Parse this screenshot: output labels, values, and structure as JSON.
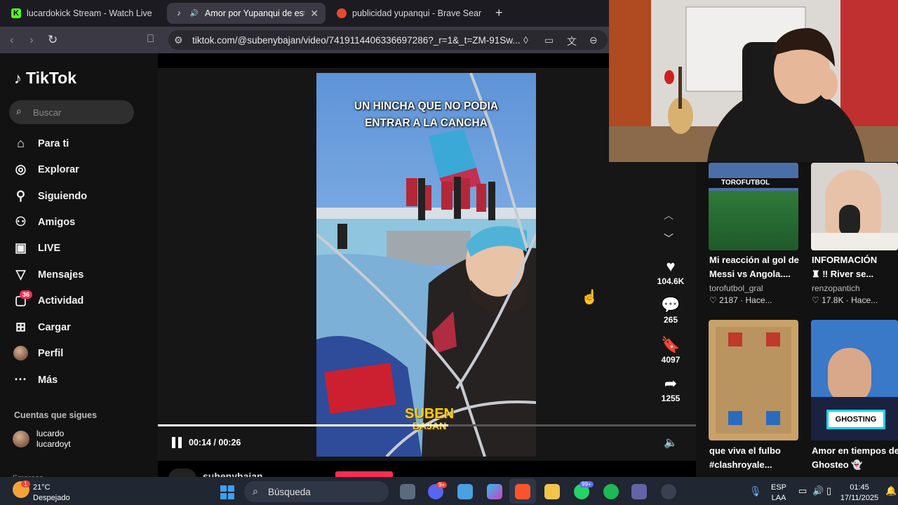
{
  "browser": {
    "tabs": [
      {
        "title": "lucardokick Stream - Watch Live on Kick",
        "icon": "kick-icon",
        "active": false
      },
      {
        "title": "Amor por Yupanqui de este hincha",
        "icon": "tiktok-icon",
        "active": true
      },
      {
        "title": "publicidad yupanqui - Brave Search",
        "icon": "brave-icon",
        "active": false
      }
    ],
    "url": "tiktok.com/@subenybajan/video/7419114406336697286?_r=1&_t=ZM-91Sw..."
  },
  "tiktok": {
    "logo": "TikTok",
    "search_placeholder": "Buscar",
    "nav": [
      {
        "label": "Para ti",
        "icon": "home-icon"
      },
      {
        "label": "Explorar",
        "icon": "compass-icon"
      },
      {
        "label": "Siguiendo",
        "icon": "following-icon"
      },
      {
        "label": "Amigos",
        "icon": "friends-icon"
      },
      {
        "label": "LIVE",
        "icon": "live-icon"
      },
      {
        "label": "Mensajes",
        "icon": "messages-icon"
      },
      {
        "label": "Actividad",
        "icon": "activity-icon"
      },
      {
        "label": "Cargar",
        "icon": "upload-icon"
      },
      {
        "label": "Perfil",
        "icon": "profile-avatar"
      },
      {
        "label": "Más",
        "icon": "more-icon"
      }
    ],
    "activity_badge": "36",
    "following_title": "Cuentas que sigues",
    "followed_account": {
      "name": "lucardo",
      "handle": "lucardoyt"
    },
    "footer_label": "Empresa"
  },
  "video": {
    "caption_line1": "UN HINCHA QUE NO PODIA",
    "caption_line2": "ENTRAR A LA CANCHA",
    "watermark_line1": "SUBEN",
    "watermark_line2": "BAJAN",
    "time": "00:14 / 00:26",
    "progress": 0.54,
    "author": "subenybajan",
    "likes": "104.6K",
    "comments": "265",
    "saves": "4097",
    "shares": "1255"
  },
  "recommended": [
    {
      "title": "Mi reacción al gol de",
      "title2": "Messi vs Angola....",
      "user": "torofutbol_gral",
      "likes": "2187",
      "time": "Hace...",
      "overlay": "TOROFUTBOL"
    },
    {
      "title": "INFORMACIÓN",
      "title2": "♜ ‼ River se...",
      "user": "renzopantich",
      "likes": "17.8K",
      "time": "Hace..."
    },
    {
      "title": "que viva el fulbo",
      "title2": "#clashroyale..."
    },
    {
      "title": "Amor en tiempos de",
      "title2": "Ghosteo 👻",
      "overlay": "GHOSTING"
    }
  ],
  "taskbar": {
    "weather_temp": "21°C",
    "weather_desc": "Despejado",
    "weather_badge": "1",
    "search_label": "Búsqueda",
    "discord_badge": "9+",
    "whatsapp_badge": "99+",
    "lang1": "ESP",
    "lang2": "LAA",
    "time": "01:45",
    "date": "17/11/2025"
  }
}
